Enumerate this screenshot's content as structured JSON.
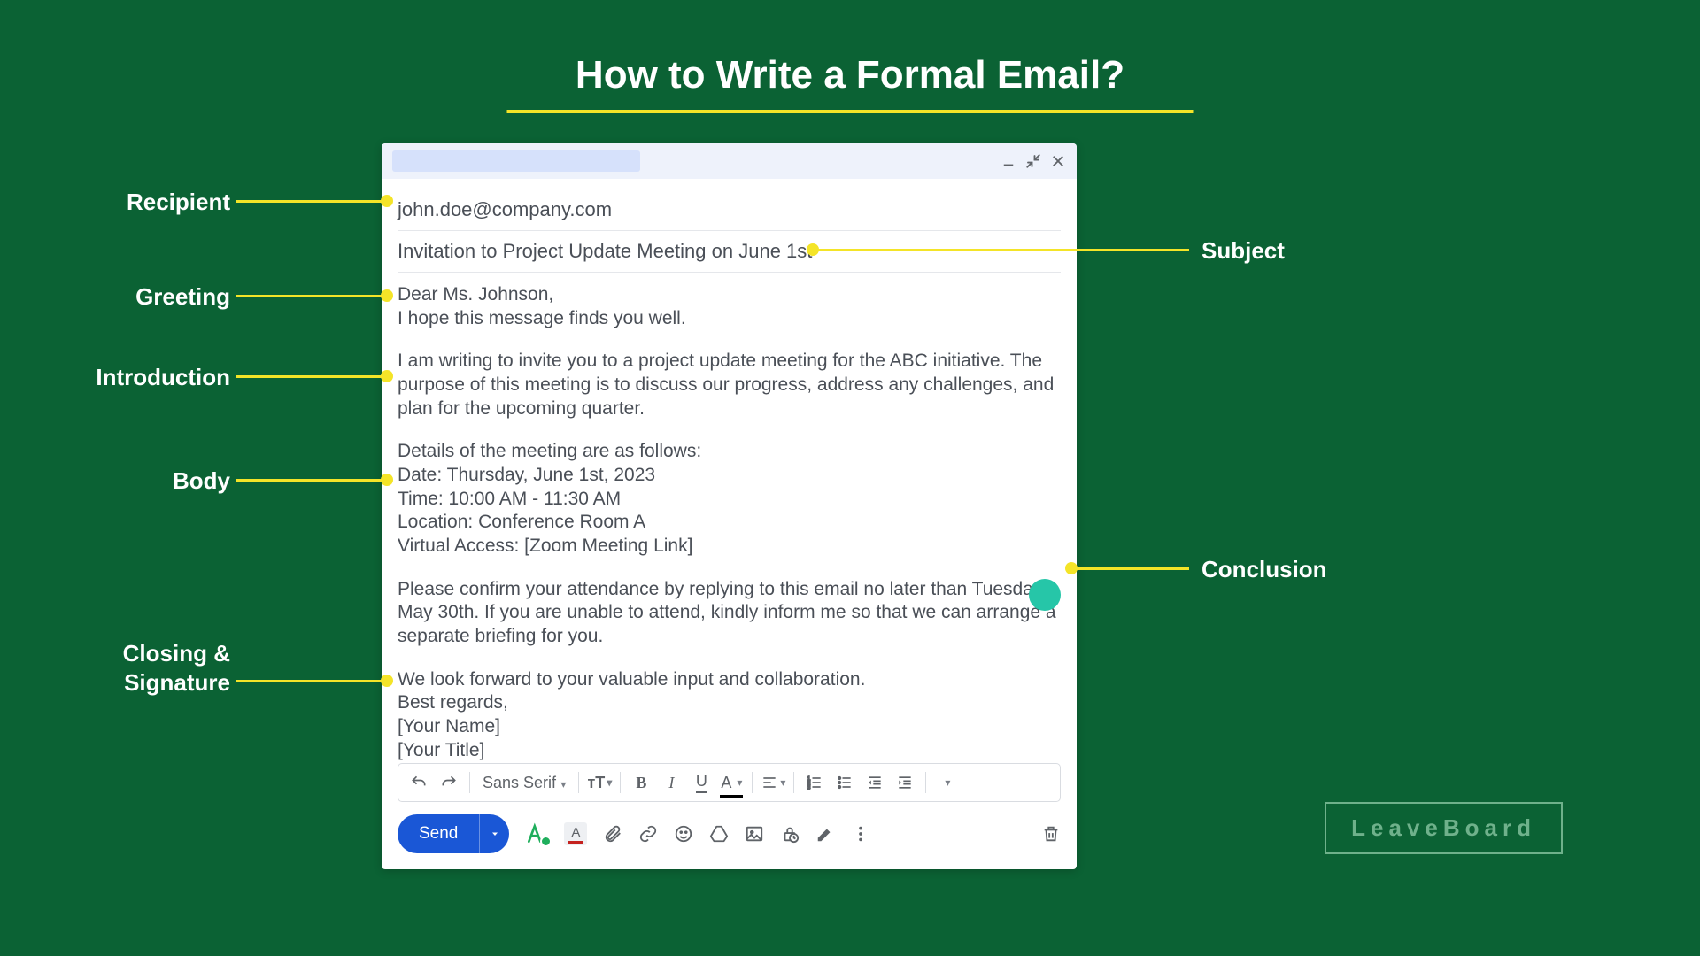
{
  "title": "How to Write a Formal Email?",
  "brand": "LeaveBoard",
  "email": {
    "recipient": "john.doe@company.com",
    "subject": "Invitation to Project Update Meeting on June 1st",
    "greeting_line1": "Dear Ms. Johnson,",
    "greeting_line2": "I hope this message finds you well.",
    "intro": "I am writing to invite you to a project update meeting for the ABC initiative. The purpose of this meeting is to discuss our progress, address any challenges, and plan for the upcoming quarter.",
    "body_header": "Details of the meeting are as follows:",
    "body_date": "Date: Thursday, June 1st, 2023",
    "body_time": "Time: 10:00 AM - 11:30 AM",
    "body_location": "Location: Conference Room A",
    "body_virtual": "Virtual Access: [Zoom Meeting Link]",
    "conclusion": "Please confirm your attendance by replying to this email no later than Tuesday, May 30th. If you are unable to attend, kindly inform me so that we can arrange a separate briefing for you.",
    "closing_line1": "We look forward to your valuable input and collaboration.",
    "closing_line2": "Best regards,",
    "closing_line3": "[Your Name]",
    "closing_line4": "[Your Title]"
  },
  "toolbar": {
    "font": "Sans Serif",
    "send": "Send"
  },
  "annotations": {
    "recipient": "Recipient",
    "greeting": "Greeting",
    "introduction": "Introduction",
    "body": "Body",
    "closing": "Closing & Signature",
    "subject": "Subject",
    "conclusion": "Conclusion"
  }
}
